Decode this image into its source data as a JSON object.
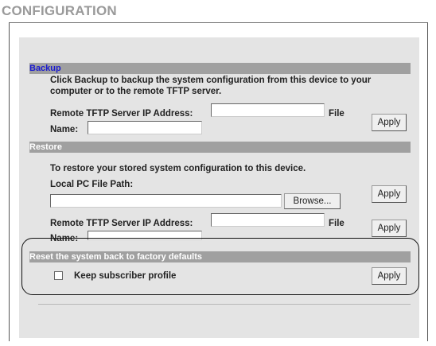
{
  "page_title": "CONFIGURATION",
  "backup": {
    "header": "Backup",
    "description_line1": "Click Backup to backup the system configuration from this device to your",
    "description_line2": "computer or to the remote TFTP server.",
    "tftp_label": "Remote TFTP Server IP Address:",
    "file_label": "File",
    "name_label": "Name:",
    "tftp_value": "",
    "name_value": "",
    "apply_label": "Apply"
  },
  "restore": {
    "header": "Restore",
    "description": "To restore your stored system configuration to this device.",
    "local_path_label": "Local PC File Path:",
    "local_path_value": "",
    "browse_label": "Browse...",
    "apply_label": "Apply",
    "tftp_label": "Remote TFTP Server IP Address:",
    "file_label": "File",
    "name_label": "Name:",
    "tftp_value": "",
    "name_value": "",
    "apply2_label": "Apply"
  },
  "reset": {
    "header": "Reset the system back to factory defaults",
    "keep_label": "Keep subscriber profile",
    "keep_checked": false,
    "apply_label": "Apply"
  }
}
